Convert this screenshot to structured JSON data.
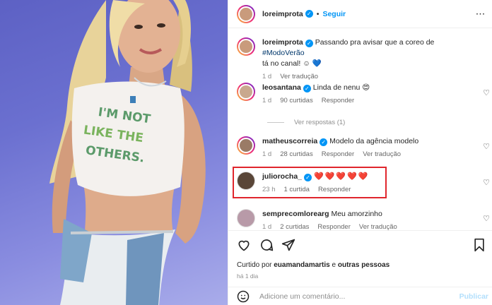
{
  "post": {
    "author": "loreimprota",
    "follow_label": "Seguir",
    "caption_author": "loreimprota",
    "caption_text": "Passando pra avisar que a coreo de",
    "caption_hashtag": "#ModoVerão",
    "caption_text2": "tá no canal! ☺ 💙",
    "caption_time": "1 d",
    "caption_translate": "Ver tradução"
  },
  "comments": [
    {
      "user": "leosantana",
      "verified": true,
      "text": "Linda de nenu 😍",
      "time": "1 d",
      "likes": "90 curtidas",
      "reply": "Responder",
      "translate": "",
      "view_replies": "Ver respostas (1)",
      "avatar_color": "#c9a88e"
    },
    {
      "user": "matheuscorreia",
      "verified": true,
      "text": "Modelo da agência modelo",
      "time": "1 d",
      "likes": "28 curtidas",
      "reply": "Responder",
      "translate": "Ver tradução",
      "avatar_color": "#9a7b66"
    },
    {
      "user": "juliorocha_",
      "verified": true,
      "text": "❤️❤️❤️❤️❤️",
      "time": "23 h",
      "likes": "1 curtida",
      "reply": "Responder",
      "translate": "",
      "avatar_color": "#5a4638"
    },
    {
      "user": "semprecomlorearg",
      "verified": false,
      "text": "Meu amorzinho",
      "time": "1 d",
      "likes": "2 curtidas",
      "reply": "Responder",
      "translate": "Ver tradução",
      "avatar_color": "#b89aa8"
    }
  ],
  "footer": {
    "liked_prefix": "Curtido por",
    "liked_user": "euamandamartis",
    "liked_mid": "e",
    "liked_others": "outras pessoas",
    "date": "há 1 dia",
    "comment_placeholder": "Adicione um comentário...",
    "publish_label": "Publicar"
  },
  "shirt_text": [
    "I'M NOT",
    "LIKE THE",
    "OTHERS."
  ],
  "colors": {
    "accent": "#0095f6",
    "highlight": "#e0262d",
    "heart": "#ed1c40",
    "photo_bg": "#6b70d0"
  }
}
